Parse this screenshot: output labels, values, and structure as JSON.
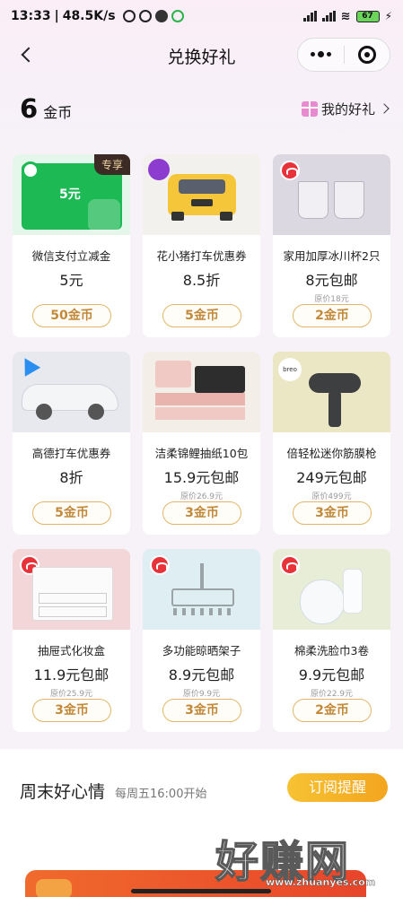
{
  "status_bar": {
    "time": "13:33",
    "speed": "48.5K/s",
    "battery": "67"
  },
  "nav": {
    "title": "兑换好礼"
  },
  "coins": {
    "amount": "6",
    "unit": "金币",
    "my_gifts": "我的好礼"
  },
  "products": [
    {
      "name": "微信支付立减金",
      "price": "5元",
      "original": "",
      "cost": "50金币",
      "tag": "专享",
      "image_text": "5元",
      "theme": "#1cb955"
    },
    {
      "name": "花小猪打车优惠券",
      "price": "8.5折",
      "original": "",
      "cost": "5金币",
      "theme": "#f5c53a"
    },
    {
      "name": "家用加厚冰川杯2只",
      "price": "8元包邮",
      "original": "原价18元",
      "cost": "2金币",
      "theme": "#dcd8e2"
    },
    {
      "name": "高德打车优惠券",
      "price": "8折",
      "original": "",
      "cost": "5金币",
      "theme": "#e7e9ee"
    },
    {
      "name": "洁柔锦鲤抽纸10包",
      "price": "15.9元包邮",
      "original": "原价26.9元",
      "cost": "3金币",
      "theme": "#f3eee8"
    },
    {
      "name": "倍轻松迷你筋膜枪",
      "price": "249元包邮",
      "original": "原价499元",
      "cost": "3金币",
      "brand_text": "breo",
      "theme": "#ebe7c4"
    },
    {
      "name": "抽屉式化妆盒",
      "price": "11.9元包邮",
      "original": "原价25.9元",
      "cost": "3金币",
      "theme": "#f3d6d8"
    },
    {
      "name": "多功能晾晒架子",
      "price": "8.9元包邮",
      "original": "原价9.9元",
      "cost": "3金币",
      "theme": "#dfeef3"
    },
    {
      "name": "棉柔洗脸巾3卷",
      "price": "9.9元包邮",
      "original": "原价22.9元",
      "cost": "2金币",
      "theme": "#e8edd7"
    }
  ],
  "weekend": {
    "title": "周末好心情",
    "subtitle": "每周五16:00开始",
    "button": "订阅提醒"
  },
  "watermark": {
    "text": "好赚网",
    "url": "www.zhuanyes.com"
  }
}
